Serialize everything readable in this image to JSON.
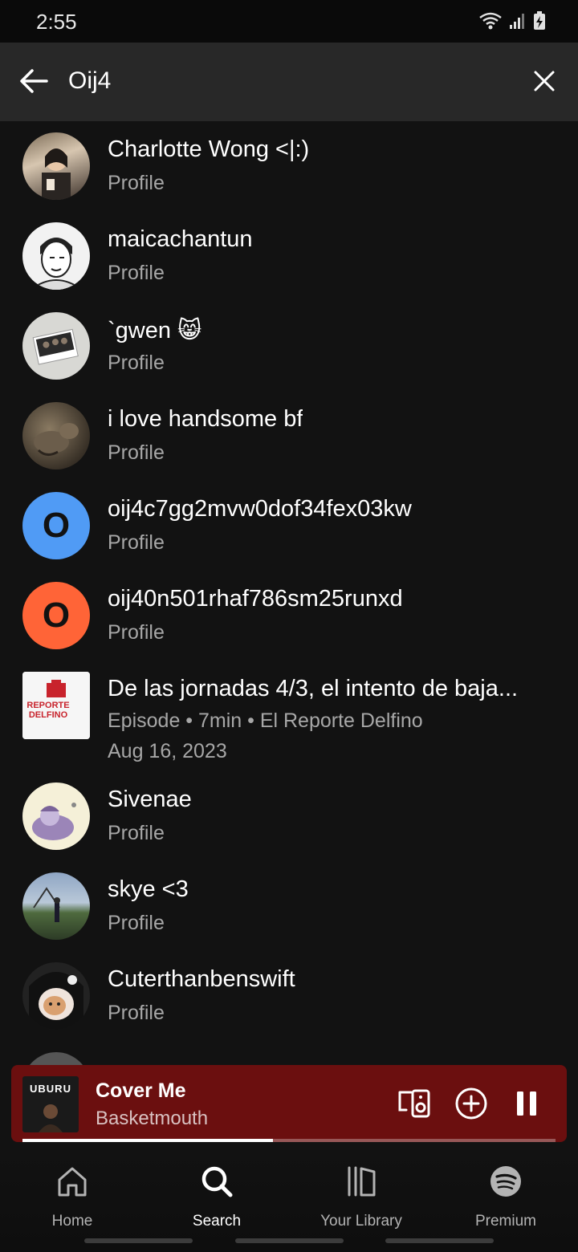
{
  "status_bar": {
    "time": "2:55"
  },
  "search": {
    "query": "Oij4"
  },
  "results": [
    {
      "title": "Charlotte Wong <|:)",
      "subtitle": "Profile",
      "kind": "profile",
      "avatar_style": "photo-cafe"
    },
    {
      "title": "maicachantun",
      "subtitle": "Profile",
      "kind": "profile",
      "avatar_style": "manga"
    },
    {
      "title": "`gwen 😸",
      "subtitle": "Profile",
      "kind": "profile",
      "avatar_style": "photo-polaroid"
    },
    {
      "title": "i love handsome bf",
      "subtitle": "Profile",
      "kind": "profile",
      "avatar_style": "photo-animal"
    },
    {
      "title": "oij4c7gg2mvw0dof34fex03kw",
      "subtitle": "Profile",
      "kind": "profile",
      "initial": "O",
      "avatar_color": "#509bf5"
    },
    {
      "title": "oij40n501rhaf786sm25runxd",
      "subtitle": "Profile",
      "kind": "profile",
      "initial": "O",
      "avatar_color": "#ff6437"
    },
    {
      "title": "De las jornadas 4/3, el intento de baja...",
      "subtitle": "Episode • 7min • El Reporte Delfino",
      "date": "Aug 16, 2023",
      "kind": "episode",
      "cover_text": "REPORTE DELFINO"
    },
    {
      "title": "Sivenae",
      "subtitle": "Profile",
      "kind": "profile",
      "avatar_style": "illustration"
    },
    {
      "title": "skye <3",
      "subtitle": "Profile",
      "kind": "profile",
      "avatar_style": "photo-park"
    },
    {
      "title": "Cuterthanbenswift",
      "subtitle": "Profile",
      "kind": "profile",
      "avatar_style": "photo-cat"
    }
  ],
  "now_playing": {
    "title": "Cover Me",
    "artist": "Basketmouth",
    "cover_text": "UBURU",
    "progress": 0.47
  },
  "nav": [
    {
      "label": "Home",
      "icon": "home-icon",
      "active": false
    },
    {
      "label": "Search",
      "icon": "search-icon",
      "active": true
    },
    {
      "label": "Your Library",
      "icon": "library-icon",
      "active": false
    },
    {
      "label": "Premium",
      "icon": "spotify-icon",
      "active": false
    }
  ],
  "colors": {
    "background": "#121212",
    "search_bar": "#282828",
    "mini_player": "#6b0f0f",
    "muted_text": "#a7a7a7"
  }
}
